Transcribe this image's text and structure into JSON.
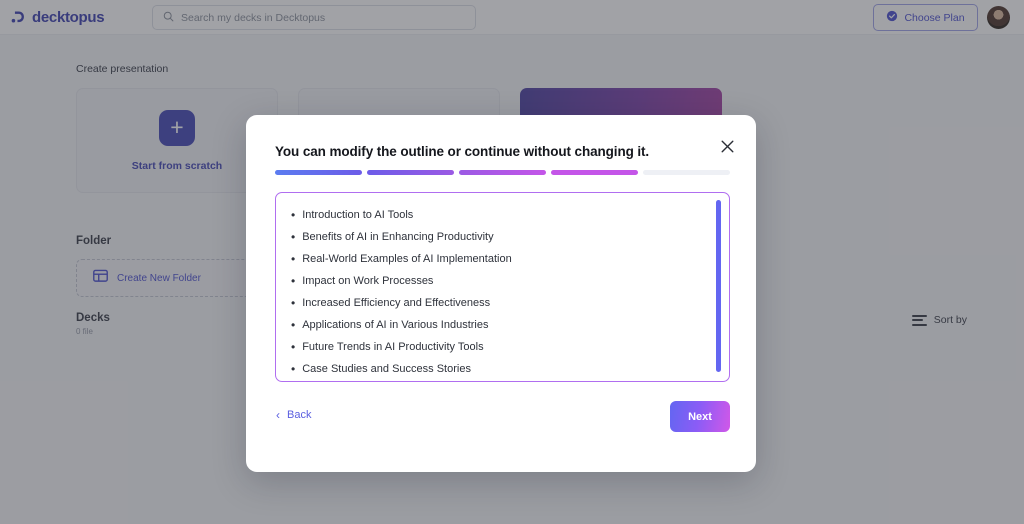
{
  "header": {
    "logo_text": "decktopus",
    "logo_icon": "decktopus-logo-icon",
    "search": {
      "placeholder": "Search my decks in Decktopus",
      "value": "",
      "icon": "search-icon"
    },
    "choose_plan": {
      "label": "Choose Plan",
      "icon": "check-circle-icon"
    },
    "avatar": "user-avatar"
  },
  "main": {
    "create_presentation_label": "Create presentation",
    "cards": [
      {
        "label": "Start from scratch",
        "icon": "plus-icon",
        "style": "plain"
      },
      {
        "label": "",
        "icon": "",
        "style": "plain"
      },
      {
        "label": "",
        "icon": "",
        "style": "gradient"
      }
    ],
    "folder_section": {
      "title": "Folder",
      "create_new_folder_label": "Create New Folder",
      "create_new_folder_icon": "folder-grid-icon"
    },
    "decks_section": {
      "title": "Decks",
      "count_label": "0 file"
    },
    "sort_by": {
      "label": "Sort by",
      "icon": "sort-lines-icon"
    }
  },
  "modal": {
    "title": "You can modify the outline or continue without changing it.",
    "close_icon": "close-icon",
    "progress": {
      "total_steps": 5,
      "completed_steps": 4,
      "segment_colors": [
        "#5b7cf0",
        "#6d5ce8",
        "#9b5ae4",
        "#c455e8",
        "#eef0f5"
      ]
    },
    "outline": {
      "border_color": "#b06ef0",
      "scrollbar_color": "#6366f1",
      "items": [
        "Introduction to AI Tools",
        "Benefits of AI in Enhancing Productivity",
        "Real-World Examples of AI Implementation",
        "Impact on Work Processes",
        "Increased Efficiency and Effectiveness",
        "Applications of AI in Various Industries",
        "Future Trends in AI Productivity Tools",
        "Case Studies and Success Stories"
      ],
      "bullet": "•"
    },
    "footer": {
      "back_label": "Back",
      "back_icon": "chevron-left-icon",
      "next_label": "Next"
    }
  },
  "colors": {
    "brand_indigo": "#4346b5",
    "link_indigo": "#4b4fd0",
    "accent_purple": "#b06ef0",
    "overlay": "rgba(56,58,65,0.47)"
  }
}
